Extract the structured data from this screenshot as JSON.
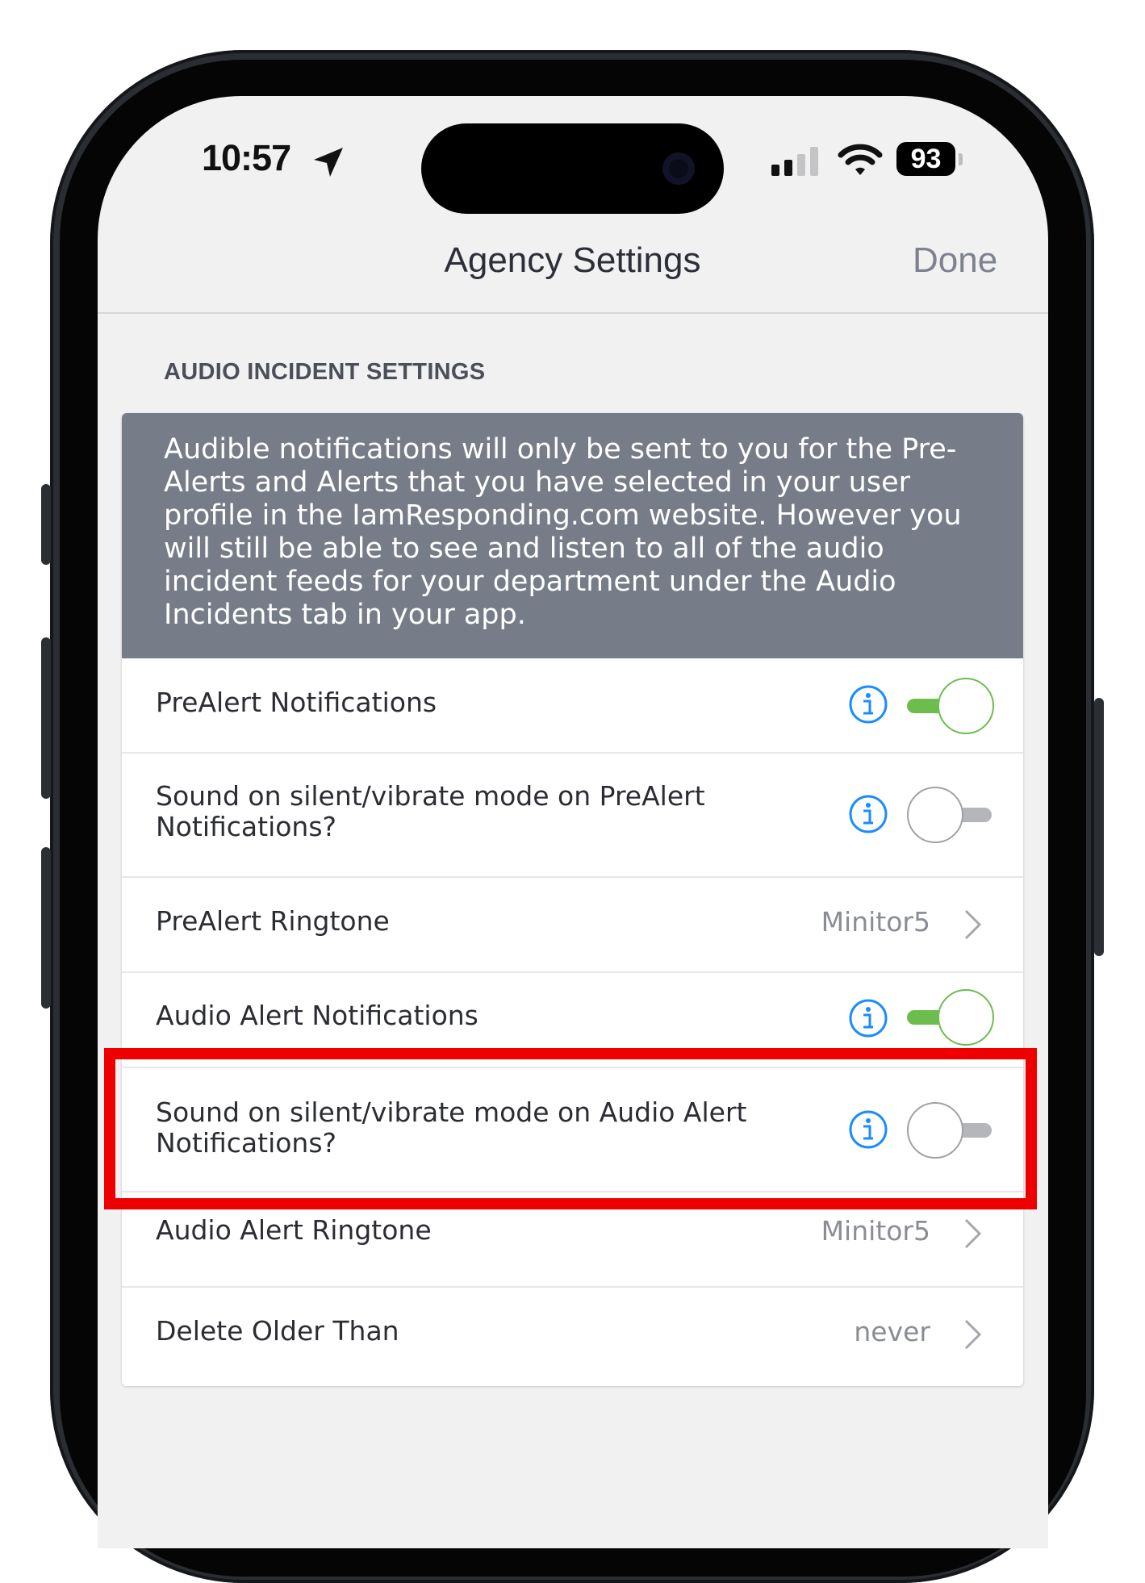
{
  "status_bar": {
    "time": "10:57",
    "battery": "93",
    "location_icon": "location-arrow-icon",
    "signal_icon": "cellular-signal-icon",
    "wifi_icon": "wifi-icon"
  },
  "nav": {
    "title": "Agency Settings",
    "done_label": "Done"
  },
  "section": {
    "header": "AUDIO INCIDENT SETTINGS",
    "info_banner": "Audible notifications will only be sent to you for the Pre-Alerts and Alerts that you have selected in your user profile in the IamResponding.com website.  However you will still be able to see and listen to all of the audio incident feeds for your department under the Audio Incidents tab in your app."
  },
  "rows": [
    {
      "label": "PreAlert Notifications",
      "type": "toggle",
      "on": true
    },
    {
      "label": "Sound on silent/vibrate mode on PreAlert Notifications?",
      "type": "toggle",
      "on": false
    },
    {
      "label": "PreAlert Ringtone",
      "type": "value",
      "value": "Minitor5"
    },
    {
      "label": "Audio Alert Notifications",
      "type": "toggle",
      "on": true
    },
    {
      "label": "Sound on silent/vibrate mode on Audio Alert Notifications?",
      "type": "toggle",
      "on": false
    },
    {
      "label": "Audio Alert Ringtone",
      "type": "value",
      "value": "Minitor5"
    },
    {
      "label": "Delete Older Than",
      "type": "value",
      "value": "never"
    }
  ],
  "colors": {
    "toggle_on": "#6cbd4e",
    "info_icon": "#1a8cff",
    "highlight": "#ee0000",
    "banner_bg": "#767c88"
  }
}
